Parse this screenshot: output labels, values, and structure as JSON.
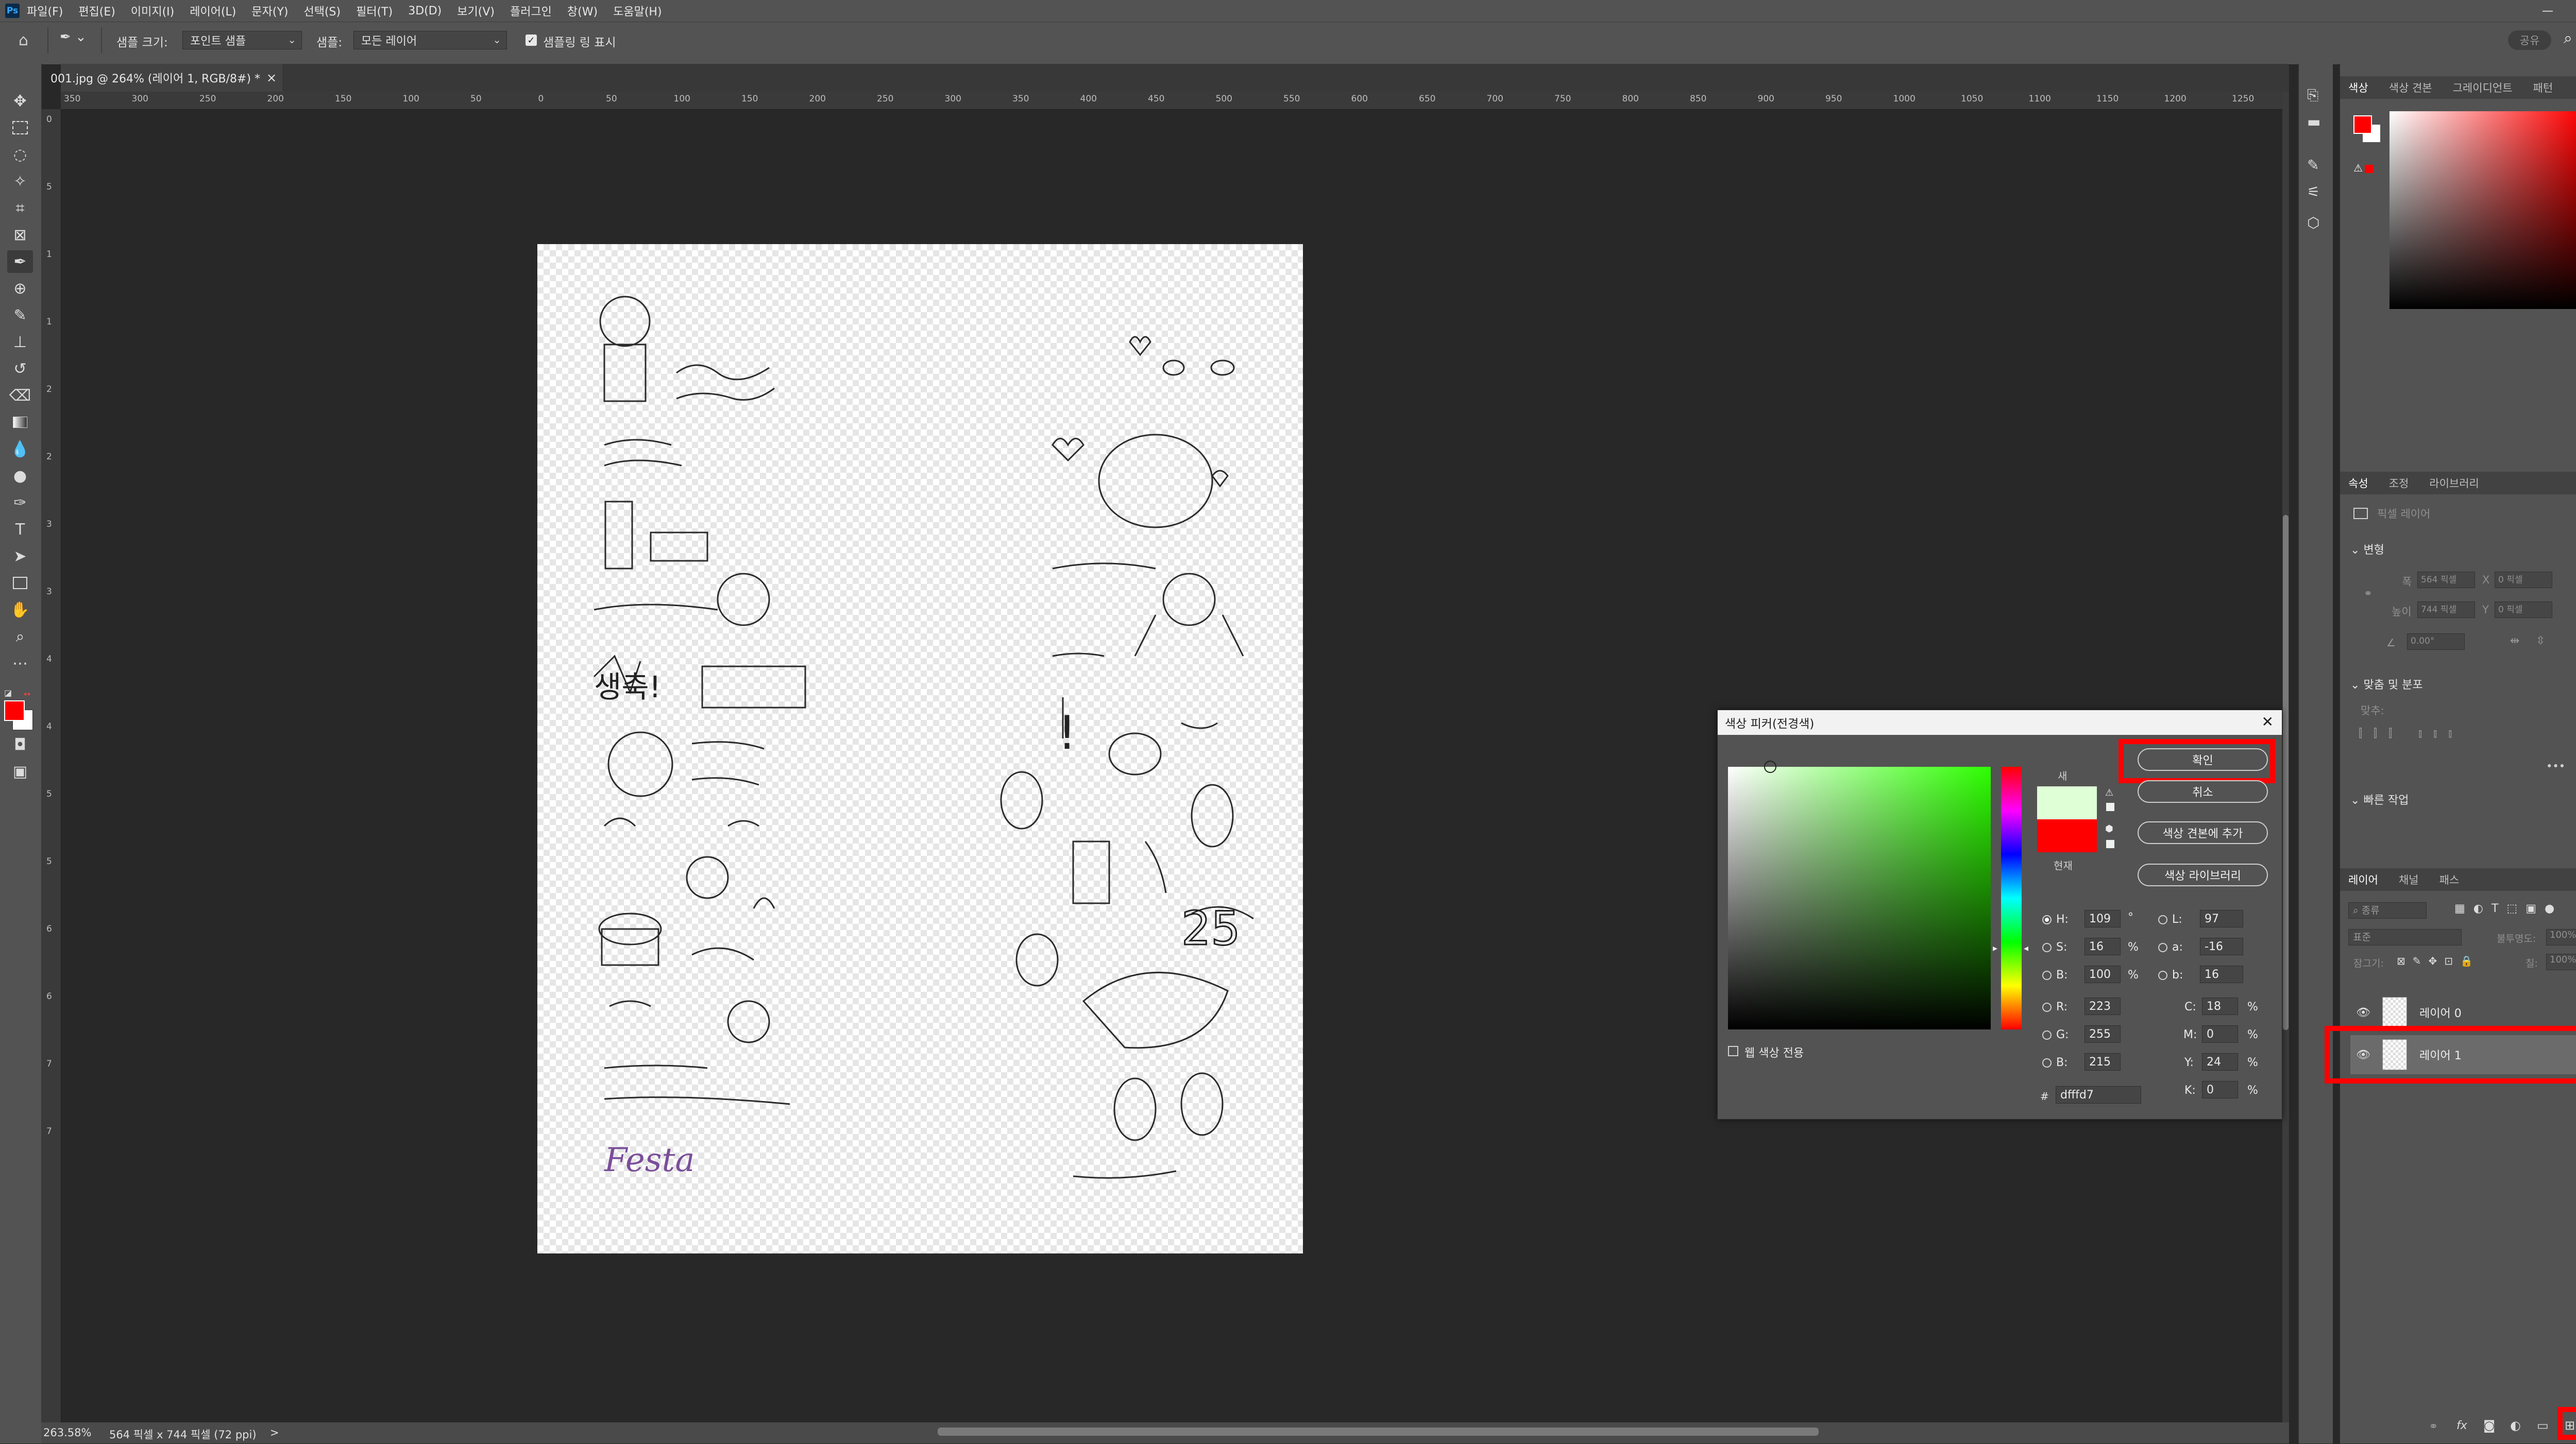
{
  "app": {
    "logo": "Ps"
  },
  "menu": [
    "파일(F)",
    "편집(E)",
    "이미지(I)",
    "레이어(L)",
    "문자(Y)",
    "선택(S)",
    "필터(T)",
    "3D(D)",
    "보기(V)",
    "플러그인",
    "창(W)",
    "도움말(H)"
  ],
  "window_controls": [
    "—",
    "❐",
    "✕"
  ],
  "options_bar": {
    "sample_size_label": "샘플 크기:",
    "sample_size_value": "포인트 샘플",
    "sample_label": "샘플:",
    "sample_value": "모든 레이어",
    "show_ring_label": "샘플링 링 표시",
    "share_label": "공유"
  },
  "document_tab": {
    "title": "001.jpg @ 264% (레이어 1, RGB/8#) *",
    "close": "×"
  },
  "ruler": {
    "h_labels": [
      "350",
      "300",
      "250",
      "200",
      "150",
      "100",
      "50",
      "0",
      "50",
      "100",
      "150",
      "200",
      "250",
      "300",
      "350",
      "400",
      "450",
      "500",
      "550",
      "600",
      "650",
      "700",
      "750",
      "800",
      "850",
      "900",
      "950",
      "1000",
      "1050",
      "1100",
      "1150",
      "1200",
      "1250"
    ],
    "v_labels": [
      "0",
      "5",
      "1",
      "1",
      "2",
      "2",
      "3",
      "3",
      "4",
      "4",
      "5",
      "5",
      "6",
      "6",
      "7",
      "7"
    ]
  },
  "status": {
    "zoom": "263.58%",
    "doc_size": "564 픽셀 x 744 픽셀 (72 ppi)",
    "arrow": ">"
  },
  "color_panel": {
    "tabs": [
      "색상",
      "색상 견본",
      "그레이디언트",
      "패턴"
    ],
    "foreground": "#ff0000",
    "background": "#ffffff"
  },
  "properties_panel": {
    "tabs": [
      "속성",
      "조정",
      "라이브러리"
    ],
    "layer_type": "픽셀 레이어",
    "transform_title": "변형",
    "w_label": "폭",
    "w_value": "564 픽셀",
    "h_label": "높이",
    "h_value": "744 픽셀",
    "x_label": "X",
    "x_value": "0 픽셀",
    "y_label": "Y",
    "y_value": "0 픽셀",
    "angle_value": "0.00°",
    "align_title": "맞춤 및 분포",
    "align_label": "맞추:",
    "more": "•••",
    "quick_title": "빠른 작업"
  },
  "layers_panel": {
    "tabs": [
      "레이어",
      "채널",
      "패스"
    ],
    "filter_placeholder": "종류",
    "blend_mode": "표준",
    "opacity_label": "불투명도:",
    "opacity_value": "100%",
    "lock_label": "잠그기:",
    "fill_label": "칠:",
    "fill_value": "100%",
    "layers": [
      {
        "name": "레이어 0"
      },
      {
        "name": "레이어 1"
      }
    ],
    "bottom_icons": [
      "link-icon",
      "fx-icon",
      "mask-icon",
      "adjustment-icon",
      "folder-icon",
      "new-layer-icon",
      "trash-icon"
    ]
  },
  "color_picker": {
    "title": "색상 피커(전경색)",
    "ok": "확인",
    "cancel": "취소",
    "add_swatch": "색상 견본에 추가",
    "color_libraries": "색상 라이브러리",
    "new_label": "새",
    "current_label": "현재",
    "new_color": "#dfffd7",
    "current_color": "#ff0000",
    "hue_color": "#2dff00",
    "web_only_label": "웹 색상 전용",
    "fields": {
      "H": "109",
      "H_unit": "°",
      "S": "16",
      "S_unit": "%",
      "B": "100",
      "B_unit": "%",
      "R": "223",
      "G": "255",
      "B2": "215",
      "L": "97",
      "a": "-16",
      "b": "16",
      "C": "18",
      "M": "0",
      "Y": "24",
      "K": "0",
      "pct": "%"
    },
    "hex": "dfffd7",
    "hash": "#"
  }
}
